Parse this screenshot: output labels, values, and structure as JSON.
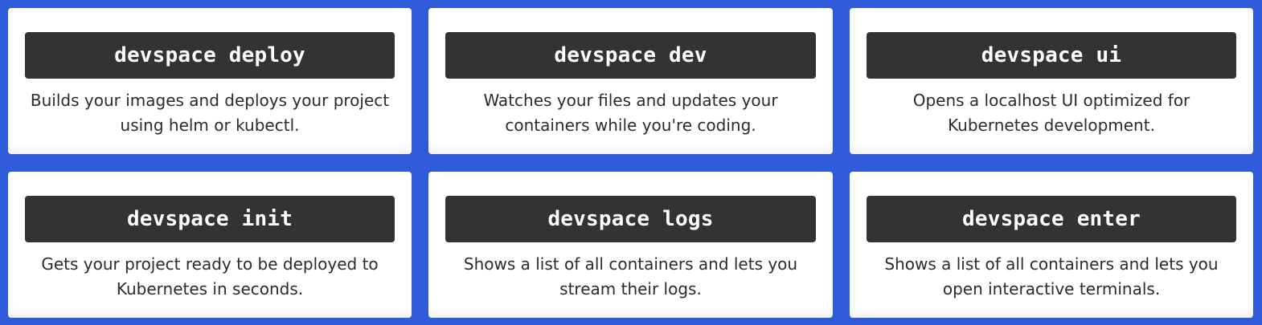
{
  "commands": [
    {
      "command": "devspace deploy",
      "description": "Builds your images and deploys your project using helm or kubectl."
    },
    {
      "command": "devspace dev",
      "description": "Watches your files and updates your containers while you're coding."
    },
    {
      "command": "devspace ui",
      "description": "Opens a localhost UI optimized for Kubernetes development."
    },
    {
      "command": "devspace init",
      "description": "Gets your project ready to be deployed to Kubernetes in seconds."
    },
    {
      "command": "devspace logs",
      "description": "Shows a list of all containers and lets you stream their logs."
    },
    {
      "command": "devspace enter",
      "description": "Shows a list of all containers and lets you open interactive terminals."
    }
  ],
  "colors": {
    "background": "#2f5bd8",
    "card": "#ffffff",
    "command_box": "#333333",
    "command_text": "#ffffff",
    "description_text": "#2b2b2b"
  }
}
